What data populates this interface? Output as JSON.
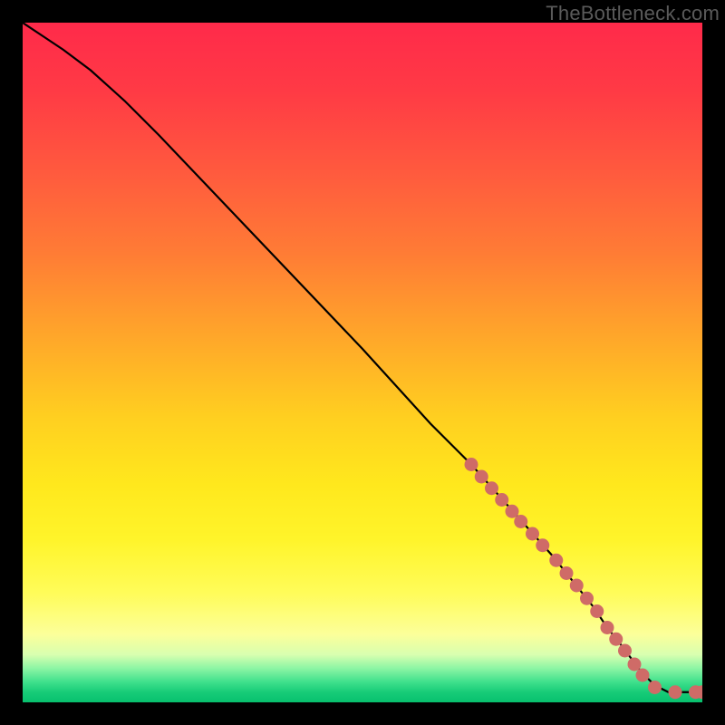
{
  "watermark": "TheBottleneck.com",
  "colors": {
    "frame": "#000000",
    "line": "#000000",
    "marker": "#cf6b67",
    "gradient_top": "#ff2a4a",
    "gradient_mid": "#ffe81d",
    "gradient_bottom": "#08c06e"
  },
  "chart_data": {
    "type": "line",
    "title": "",
    "xlabel": "",
    "ylabel": "",
    "xlim": [
      0,
      100
    ],
    "ylim": [
      0,
      100
    ],
    "grid": false,
    "legend": false,
    "series": [
      {
        "name": "curve",
        "x": [
          0,
          3,
          6,
          10,
          15,
          20,
          30,
          40,
          50,
          60,
          66,
          70,
          74,
          78,
          80,
          82,
          84,
          86,
          88,
          89.5,
          91,
          93,
          95,
          97,
          99,
          100
        ],
        "y": [
          100,
          98,
          96,
          93,
          88.5,
          83.5,
          73,
          62.5,
          52,
          41,
          35,
          30.5,
          26,
          21.5,
          19,
          16.5,
          14,
          11,
          8.5,
          6.5,
          4.5,
          2.5,
          1.5,
          1.5,
          1.5,
          1.5
        ]
      }
    ],
    "markers": [
      {
        "x": 66,
        "y": 35
      },
      {
        "x": 67.5,
        "y": 33.2
      },
      {
        "x": 69,
        "y": 31.5
      },
      {
        "x": 70.5,
        "y": 29.8
      },
      {
        "x": 72,
        "y": 28.1
      },
      {
        "x": 73.3,
        "y": 26.6
      },
      {
        "x": 75,
        "y": 24.8
      },
      {
        "x": 76.5,
        "y": 23.1
      },
      {
        "x": 78.5,
        "y": 20.9
      },
      {
        "x": 80,
        "y": 19
      },
      {
        "x": 81.5,
        "y": 17.2
      },
      {
        "x": 83,
        "y": 15.3
      },
      {
        "x": 84.5,
        "y": 13.4
      },
      {
        "x": 86,
        "y": 11
      },
      {
        "x": 87.3,
        "y": 9.3
      },
      {
        "x": 88.6,
        "y": 7.6
      },
      {
        "x": 90,
        "y": 5.6
      },
      {
        "x": 91.2,
        "y": 4
      },
      {
        "x": 93,
        "y": 2.2
      },
      {
        "x": 96,
        "y": 1.5
      },
      {
        "x": 99,
        "y": 1.5
      },
      {
        "x": 100,
        "y": 1.5
      }
    ]
  }
}
